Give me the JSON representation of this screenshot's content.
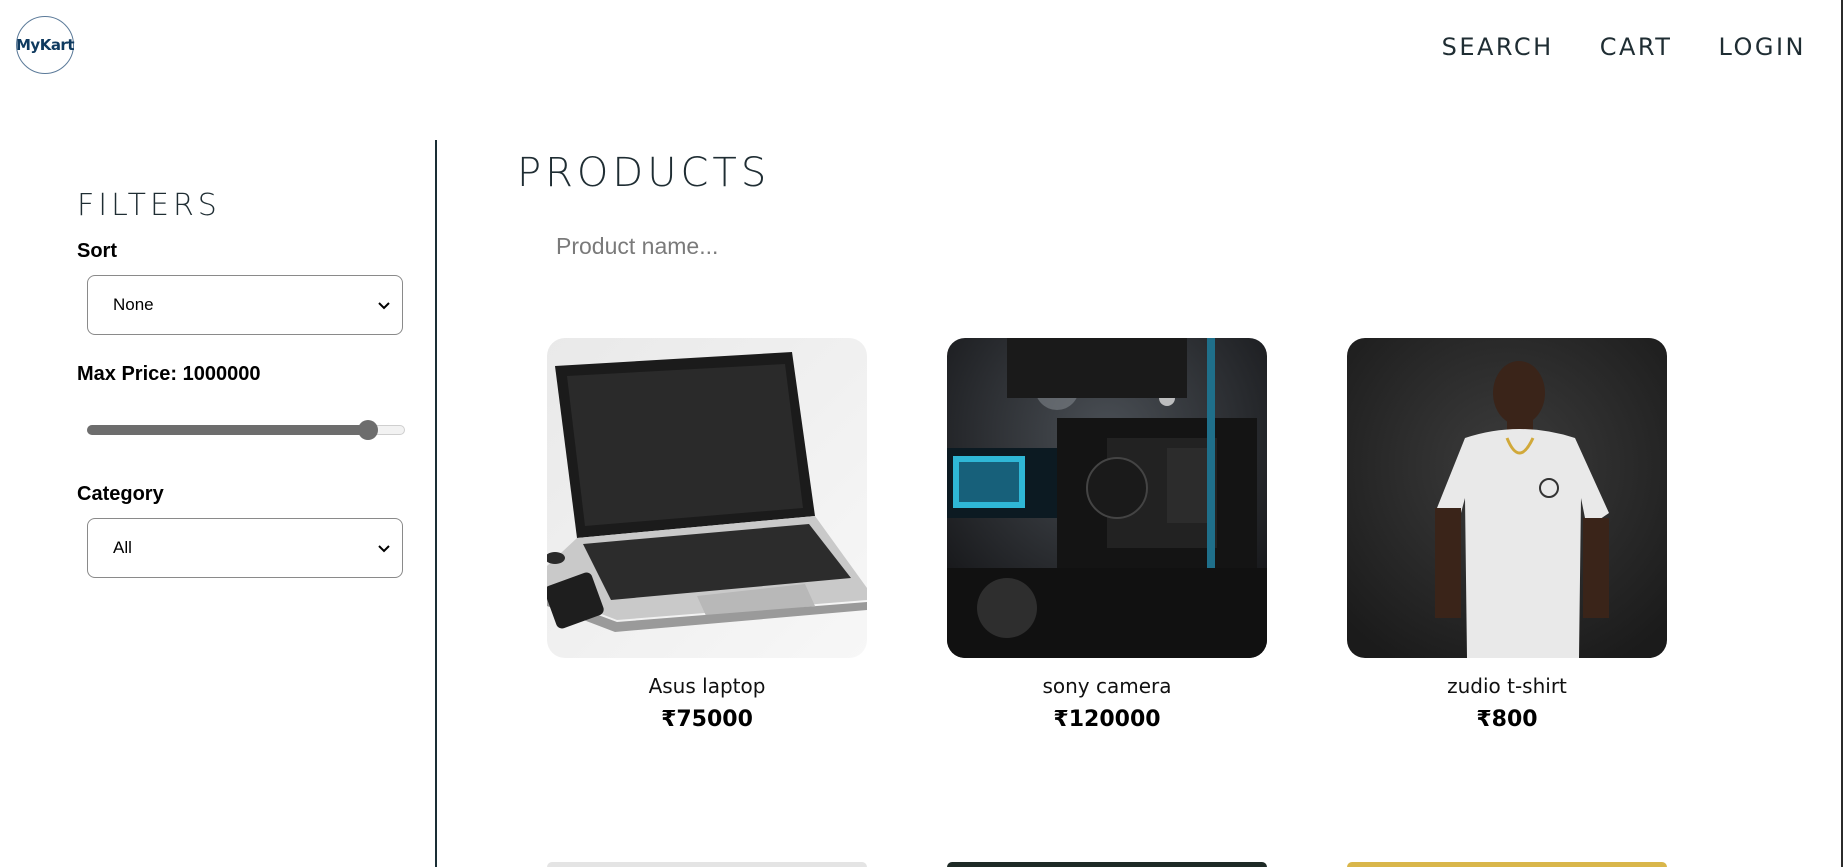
{
  "header": {
    "logo_text": "MyKart",
    "nav": [
      "SEARCH",
      "CART",
      "LOGIN"
    ]
  },
  "filters": {
    "title": "FILTERS",
    "sort": {
      "label": "Sort",
      "value": "None"
    },
    "max_price": {
      "label": "Max Price: 1000000",
      "value": 1000000,
      "fill_fraction": 0.91
    },
    "category": {
      "label": "Category",
      "value": "All"
    }
  },
  "products": {
    "title": "PRODUCTS",
    "search_placeholder": "Product name...",
    "items": [
      {
        "name": "Asus laptop",
        "price": "₹75000",
        "image": "laptop-image"
      },
      {
        "name": "sony camera",
        "price": "₹120000",
        "image": "camera-image"
      },
      {
        "name": "zudio t-shirt",
        "price": "₹800",
        "image": "tshirt-image"
      }
    ]
  },
  "colors": {
    "accent_dark": "#1f2d33",
    "divider": "#1a2e35",
    "slider": "#6d6d6d"
  }
}
